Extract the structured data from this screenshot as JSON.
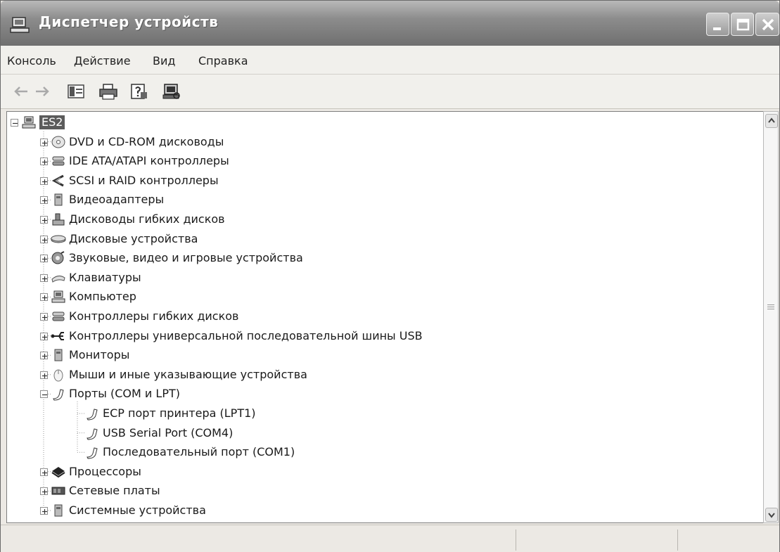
{
  "window": {
    "title": "Диспетчер устройств"
  },
  "menu": {
    "items": [
      "Консоль",
      "Действие",
      "Вид",
      "Справка"
    ]
  },
  "toolbar": {
    "buttons": [
      "back-arrow-icon",
      "forward-arrow-icon",
      "properties-icon",
      "print-icon",
      "help-icon",
      "scan-hardware-icon"
    ]
  },
  "tree": {
    "root": "ES2",
    "items": [
      {
        "label": "DVD и CD-ROM дисководы",
        "icon": "dvd-drive-icon"
      },
      {
        "label": "IDE ATA/ATAPI контроллеры",
        "icon": "ide-controller-icon"
      },
      {
        "label": "SCSI и RAID контроллеры",
        "icon": "scsi-controller-icon"
      },
      {
        "label": "Видеоадаптеры",
        "icon": "display-adapter-icon"
      },
      {
        "label": "Дисководы гибких дисков",
        "icon": "floppy-drive-icon"
      },
      {
        "label": "Дисковые устройства",
        "icon": "disk-drive-icon"
      },
      {
        "label": "Звуковые, видео и игровые устройства",
        "icon": "sound-device-icon"
      },
      {
        "label": "Клавиатуры",
        "icon": "keyboard-icon"
      },
      {
        "label": "Компьютер",
        "icon": "computer-icon"
      },
      {
        "label": "Контроллеры гибких дисков",
        "icon": "floppy-controller-icon"
      },
      {
        "label": "Контроллеры универсальной последовательной шины USB",
        "icon": "usb-icon"
      },
      {
        "label": "Мониторы",
        "icon": "monitor-icon"
      },
      {
        "label": "Мыши и иные указывающие устройства",
        "icon": "mouse-icon"
      },
      {
        "label": "Порты (COM и LPT)",
        "icon": "port-icon",
        "expanded": true,
        "children": [
          {
            "label": "ECP порт принтера (LPT1)",
            "icon": "port-icon"
          },
          {
            "label": "USB Serial Port (COM4)",
            "icon": "port-icon"
          },
          {
            "label": "Последовательный порт (COM1)",
            "icon": "port-icon"
          }
        ]
      },
      {
        "label": "Процессоры",
        "icon": "processor-icon"
      },
      {
        "label": "Сетевые платы",
        "icon": "network-card-icon"
      },
      {
        "label": "Системные устройства",
        "icon": "system-device-icon"
      }
    ]
  }
}
